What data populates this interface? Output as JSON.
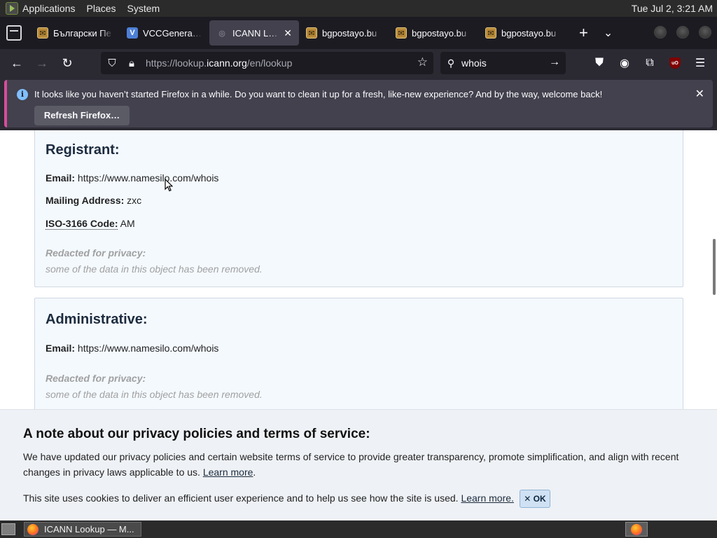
{
  "top_panel": {
    "menus": [
      "Applications",
      "Places",
      "System"
    ],
    "clock": "Tue Jul  2,  3:21 AM"
  },
  "tabs": [
    {
      "label": "Български Пе",
      "favicon": "bgpostayo-icon",
      "active": false
    },
    {
      "label": "VCCGenerator",
      "favicon": "v-icon",
      "active": false
    },
    {
      "label": "ICANN Lookup",
      "favicon": "icann-icon",
      "active": true
    },
    {
      "label": "bgpostayo.bu",
      "favicon": "bgpostayo-icon",
      "active": false
    },
    {
      "label": "bgpostayo.bu",
      "favicon": "bgpostayo-icon",
      "active": false
    },
    {
      "label": "bgpostayo.bu",
      "favicon": "bgpostayo-icon",
      "active": false
    }
  ],
  "navbar": {
    "url_prefix": "https://lookup.",
    "url_domain": "icann.org",
    "url_suffix": "/en/lookup",
    "search_value": "whois"
  },
  "notification": {
    "message": "It looks like you haven’t started Firefox in a while. Do you want to clean it up for a fresh, like-new experience? And by the way, welcome back!",
    "button_label": "Refresh Firefox…",
    "accent_color": "#d74d9b"
  },
  "registrant": {
    "heading": "Registrant:",
    "email_label": "Email:",
    "email_value": "https://www.namesilo.com/whois",
    "address_label": "Mailing Address:",
    "address_value": "zxc",
    "iso_label": "ISO-3166 Code:",
    "iso_value": "AM",
    "redacted_heading": "Redacted for privacy:",
    "redacted_text": "some of the data in this object has been removed."
  },
  "administrative": {
    "heading": "Administrative:",
    "email_label": "Email:",
    "email_value": "https://www.namesilo.com/whois",
    "redacted_heading": "Redacted for privacy:",
    "redacted_text": "some of the data in this object has been removed."
  },
  "privacy_banner": {
    "heading": "A note about our privacy policies and terms of service:",
    "paragraph1": "We have updated our privacy policies and certain website terms of service to provide greater transparency, promote simplification, and align with recent changes in privacy laws applicable to us.",
    "learn_more_1": "Learn more",
    "period": ".",
    "paragraph2": "This site uses cookies to deliver an efficient user experience and to help us see how the site is used.",
    "learn_more_2": "Learn more.",
    "ok_label": "✕ OK"
  },
  "taskbar": {
    "window_title": "ICANN Lookup — M..."
  }
}
